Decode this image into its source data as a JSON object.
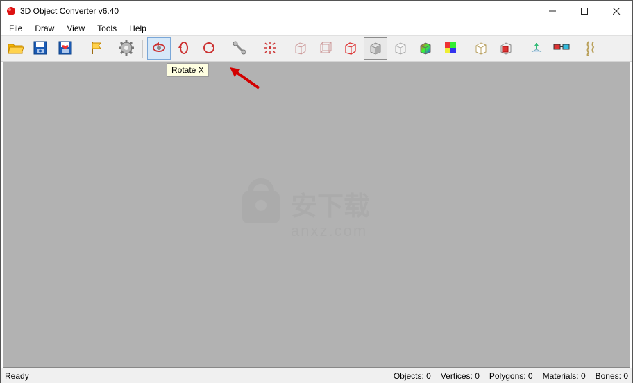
{
  "title": "3D Object Converter v6.40",
  "menu": {
    "file": "File",
    "draw": "Draw",
    "view": "View",
    "tools": "Tools",
    "help": "Help"
  },
  "tooltip": "Rotate X",
  "status": {
    "ready": "Ready",
    "objects": "Objects: 0",
    "vertices": "Vertices: 0",
    "polygons": "Polygons: 0",
    "materials": "Materials: 0",
    "bones": "Bones: 0"
  },
  "watermark": {
    "text1": "安下载",
    "text2": "anxz.com"
  }
}
